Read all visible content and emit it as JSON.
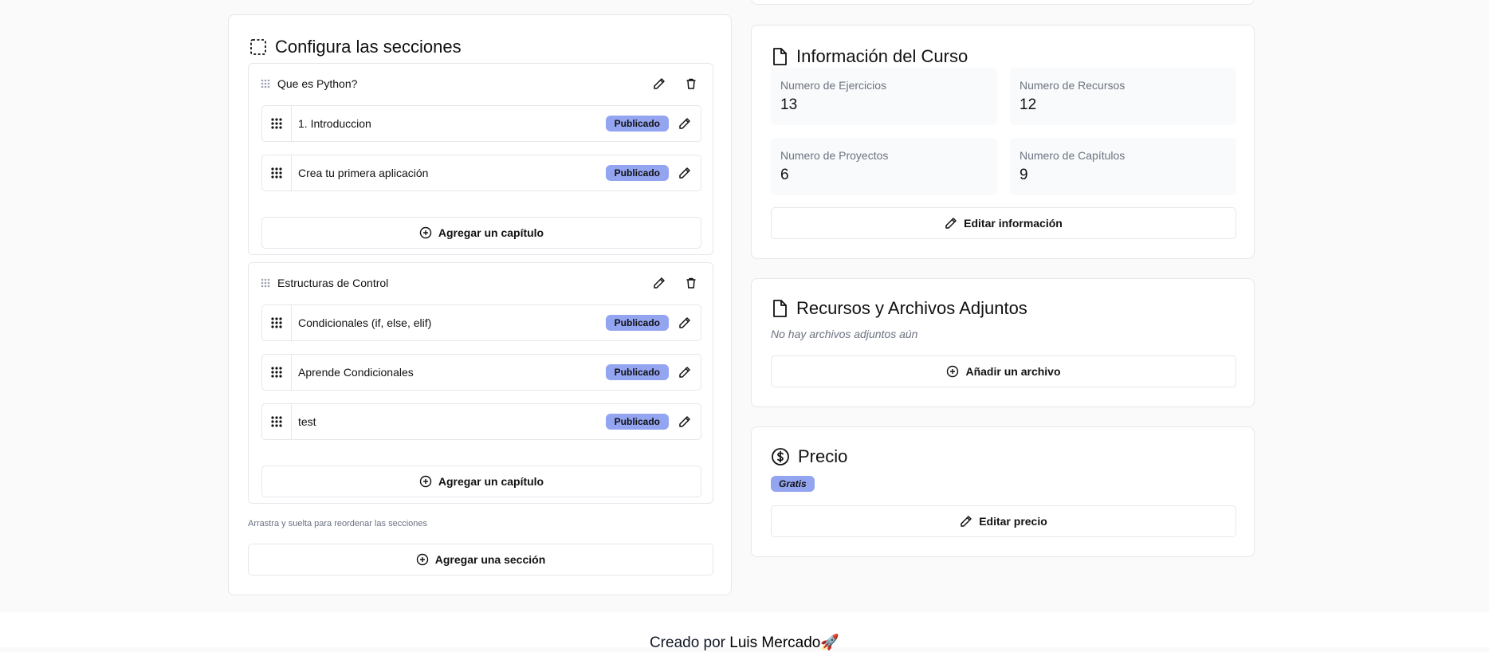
{
  "sections_card": {
    "title": "Configura las secciones",
    "sections": [
      {
        "name": "Que es Python?",
        "chapters": [
          {
            "title": "1. Introduccion",
            "status": "Publicado"
          },
          {
            "title": "Crea tu primera aplicación",
            "status": "Publicado"
          }
        ],
        "add_chapter_label": "Agregar un capítulo"
      },
      {
        "name": "Estructuras de Control",
        "chapters": [
          {
            "title": "Condicionales (if, else, elif)",
            "status": "Publicado"
          },
          {
            "title": "Aprende Condicionales",
            "status": "Publicado"
          },
          {
            "title": "test",
            "status": "Publicado"
          }
        ],
        "add_chapter_label": "Agregar un capítulo"
      }
    ],
    "reorder_hint": "Arrastra y suelta para reordenar las secciones",
    "add_section_label": "Agregar una sección"
  },
  "course_info": {
    "title": "Información del Curso",
    "stats": [
      {
        "label": "Numero de Ejercicios",
        "value": "13"
      },
      {
        "label": "Numero de Recursos",
        "value": "12"
      },
      {
        "label": "Numero de Proyectos",
        "value": "6"
      },
      {
        "label": "Numero de Capítulos",
        "value": "9"
      }
    ],
    "edit_label": "Editar información"
  },
  "resources": {
    "title": "Recursos y Archivos Adjuntos",
    "empty_text": "No hay archivos adjuntos aún",
    "add_label": "Añadir un archivo"
  },
  "price": {
    "title": "Precio",
    "badge": "Gratis",
    "edit_label": "Editar precio"
  },
  "footer": {
    "prefix": "Creado por ",
    "author": "Luis Mercado",
    "emoji": "🚀"
  },
  "colors": {
    "badge_bg": "#93a4f0",
    "border": "#e5e7eb",
    "muted_text": "#6b7280"
  }
}
